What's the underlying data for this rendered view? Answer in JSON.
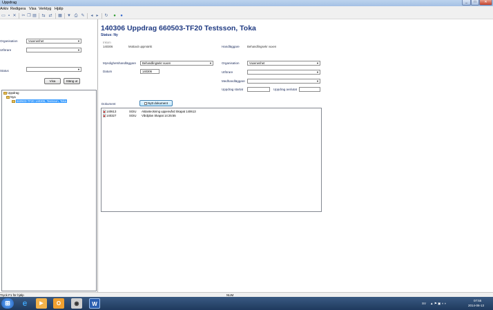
{
  "window": {
    "title": "Uppdrag"
  },
  "menu": [
    "Arkiv",
    "Redigera",
    "Visa",
    "Verktyg",
    "Hjälp"
  ],
  "toolbar_icons": [
    "new-icon",
    "save-icon",
    "delete-icon",
    "cut-icon",
    "copy-icon",
    "paste-icon",
    "link-icon",
    "link-icon",
    "grid-icon",
    "filter-icon",
    "print-icon",
    "edit-icon",
    "back-icon",
    "forward-icon",
    "refresh-icon",
    "add-icon",
    "help-icon"
  ],
  "left": {
    "organisation_label": "Organisation",
    "organisation_value": "Vuxenenhet",
    "utfoare_label": "Utförare",
    "utfoare_value": "",
    "status_label": "Status",
    "status_value": "",
    "visa_button": "Visa",
    "stang_button": "Stäng ut",
    "tree": {
      "root": "Uppdrag",
      "child": "Nya",
      "leaf": "660503-TF20 140306, Testsson, Toka"
    }
  },
  "main": {
    "title": "140306 Uppdrag 660503-TF20 Testsson, Toka",
    "status": "Status: Ny",
    "inkom_label": "Inkom",
    "inkom_value": "140306",
    "inkom_note": "Mottaxit uppmärkt",
    "handlaggare_label": "Handläggare",
    "handlaggare_value": "Behandlingsekr vuxen",
    "myndighet_label": "Myndighetshandläggare",
    "myndighet_value": "Behandlingsekr vuxen",
    "datum_label": "Datum",
    "datum_value": "140306",
    "org_label": "Organisation",
    "org_value": "Vuxenenhet",
    "utforare_label": "Utförare",
    "utforare_value": "",
    "medhandlaggare_label": "Medhandläggare",
    "medhandlaggare_value": "",
    "uppdrag_startat_label": "Uppdrag startat",
    "uppdrag_startat_value": "",
    "uppdrag_avslutat_label": "Uppdrag avslutat",
    "uppdrag_avslutat_value": "",
    "dokument_label": "Dokument",
    "nytt_dokument_button": "Nytt dokument",
    "documents": [
      {
        "id": "140613",
        "type": "SGIU",
        "desc": "Aktanteckning uppenvård Skapat 140613"
      },
      {
        "id": "140327",
        "type": "SGIU",
        "desc": "Vårdplan Skapat 14:25:55"
      }
    ]
  },
  "statusbar": {
    "left": "Tryck F1 för hjälp",
    "center": "NUM"
  },
  "taskbar": {
    "apps": [
      "start-orb-icon",
      "internet-explorer-icon",
      "media-player-icon",
      "outlook-icon",
      "app-icon",
      "word-icon"
    ],
    "lang": "SV",
    "time": "07:55",
    "date": "2014-06-13"
  },
  "colors": {
    "accent": "#1f3a82",
    "selection": "#3399ff",
    "taskbar": "#1f3a5e"
  }
}
